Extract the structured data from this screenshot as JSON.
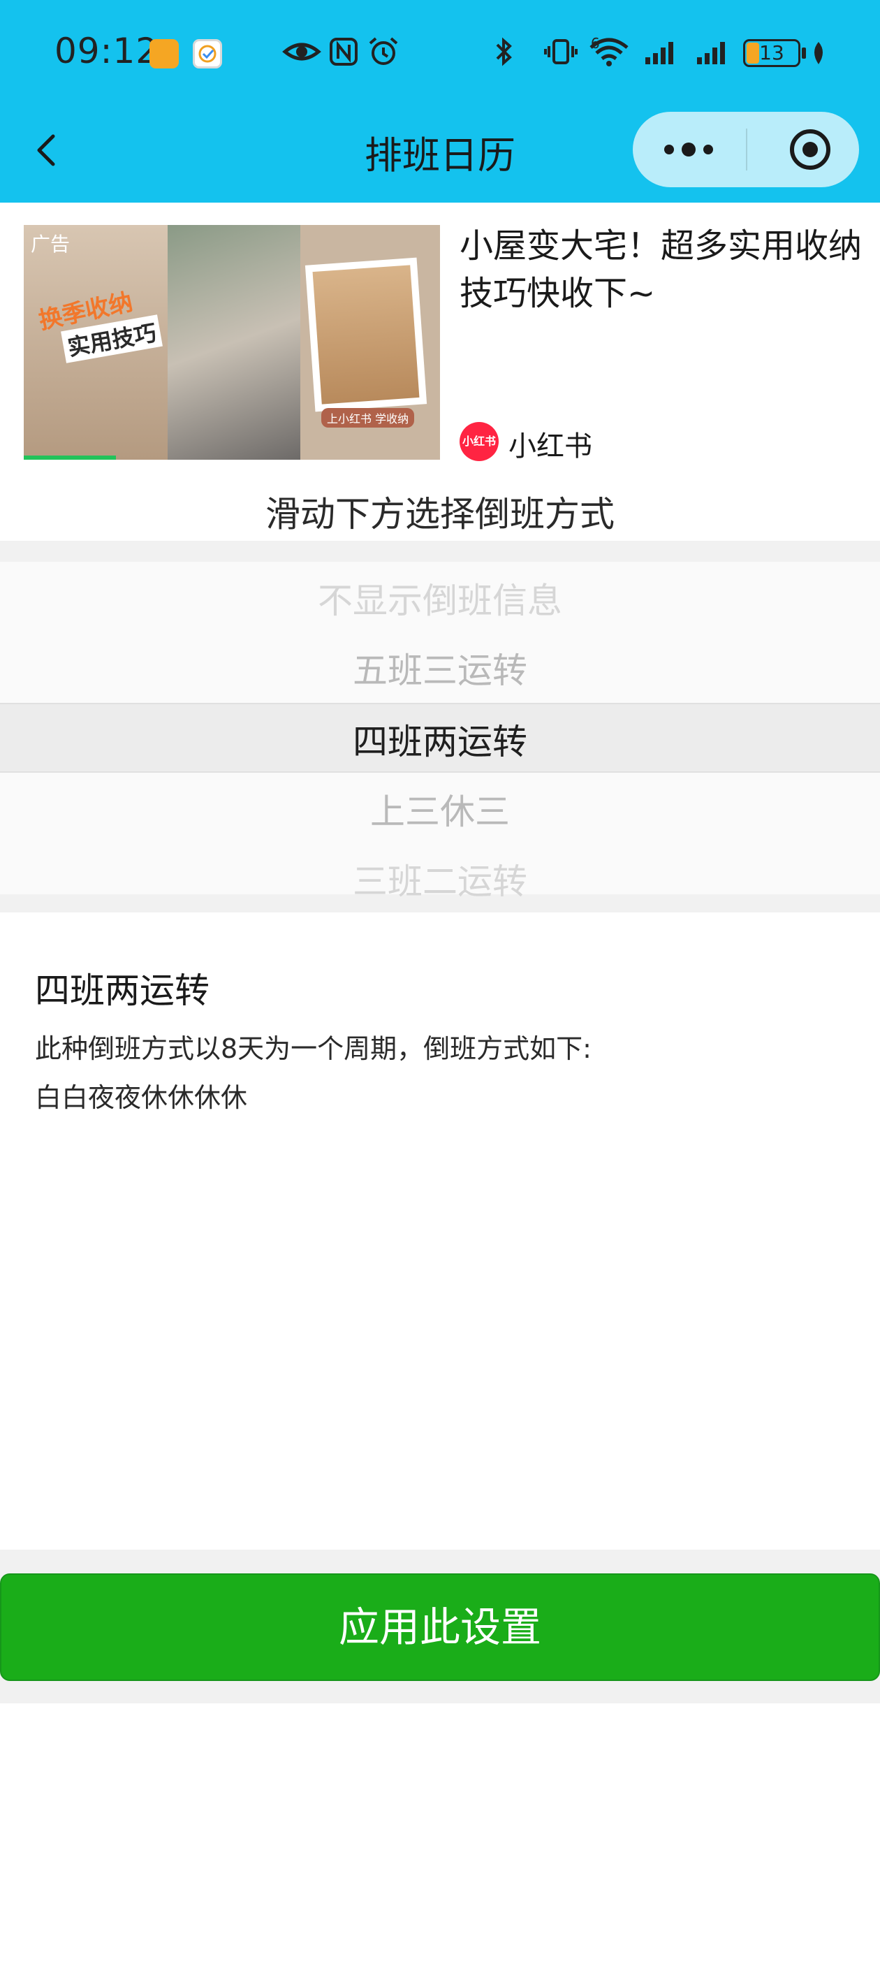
{
  "status_bar": {
    "time": "09:12",
    "battery": "13",
    "signal_label": "6"
  },
  "nav": {
    "title": "排班日历",
    "back_icon": "chevron-left-icon",
    "more_icon": "more-dots-icon",
    "close_icon": "target-circle-icon"
  },
  "ad": {
    "badge": "广告",
    "image_text_1": "换季收纳",
    "image_text_2": "实用技巧",
    "image_text_3": "上小红书 学收纳",
    "title": "小屋变大宅！超多实用收纳技巧快收下~",
    "brand_logo_text": "小红书",
    "brand_name": "小红书"
  },
  "picker": {
    "hint": "滑动下方选择倒班方式",
    "options": [
      "不显示倒班信息",
      "五班三运转",
      "四班两运转",
      "上三休三",
      "三班二运转"
    ],
    "selected_index": 2
  },
  "description": {
    "title": "四班两运转",
    "line1": "此种倒班方式以8天为一个周期，倒班方式如下:",
    "line2": "白白夜夜休休休休"
  },
  "apply_button": {
    "label": "应用此设置"
  },
  "colors": {
    "header_bg": "#14c2ee",
    "apply_green": "#1aad19",
    "brand_red": "#ff2442"
  }
}
